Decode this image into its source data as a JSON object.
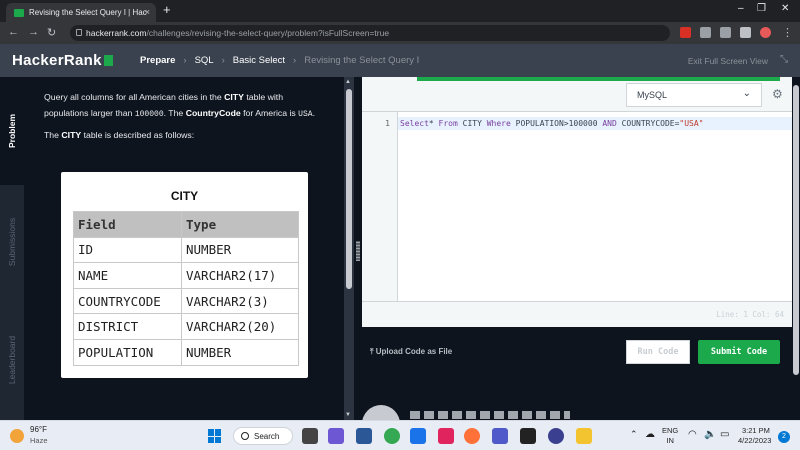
{
  "browser": {
    "tab_title": "Revising the Select Query I | Hac",
    "tab_close": "×",
    "new_tab": "+",
    "url_host": "hackerrank.com",
    "url_path": "/challenges/revising-the-select-query/problem?isFullScreen=true",
    "minimize": "–",
    "maximize": "❐",
    "close": "✕"
  },
  "header": {
    "logo": "HackerRank",
    "crumbs": [
      "Prepare",
      "SQL",
      "Basic Select",
      "Revising the Select Query I"
    ],
    "exit_fullscreen": "Exit Full Screen View"
  },
  "side_tabs": {
    "problem": "Problem",
    "submissions": "Submissions",
    "leaderboard": "Leaderboard"
  },
  "problem": {
    "p1_a": "Query all columns for all American cities in the ",
    "p1_b": "CITY",
    "p1_c": " table with populations larger than ",
    "p1_d": "100000",
    "p1_e": ". The ",
    "p1_f": "CountryCode",
    "p1_g": " for America is ",
    "p1_h": "USA",
    "p1_i": ".",
    "p2_a": "The ",
    "p2_b": "CITY",
    "p2_c": " table is described as follows:",
    "table_title": "CITY",
    "table_headers": [
      "Field",
      "Type"
    ],
    "table_rows": [
      [
        "ID",
        "NUMBER"
      ],
      [
        "NAME",
        "VARCHAR2(17)"
      ],
      [
        "COUNTRYCODE",
        "VARCHAR2(3)"
      ],
      [
        "DISTRICT",
        "VARCHAR2(20)"
      ],
      [
        "POPULATION",
        "NUMBER"
      ]
    ]
  },
  "editor": {
    "language": "MySQL",
    "line_number": "1",
    "code": {
      "t1": "Select",
      "t2": "* ",
      "t3": "From",
      "t4": " CITY ",
      "t5": "Where",
      "t6": " POPULATION>100000 ",
      "t7": "AND",
      "t8": " COUNTRYCODE=",
      "t9": "\"USA\""
    },
    "cursor": "Line: 1 Col: 64",
    "upload": "Upload Code as File",
    "run": "Run Code",
    "submit": "Submit Code"
  },
  "taskbar": {
    "temp": "96°F",
    "condition": "Haze",
    "search": "Search",
    "lang1": "ENG",
    "lang2": "IN",
    "time": "3:21 PM",
    "date": "4/22/2023",
    "notifications": "2"
  }
}
